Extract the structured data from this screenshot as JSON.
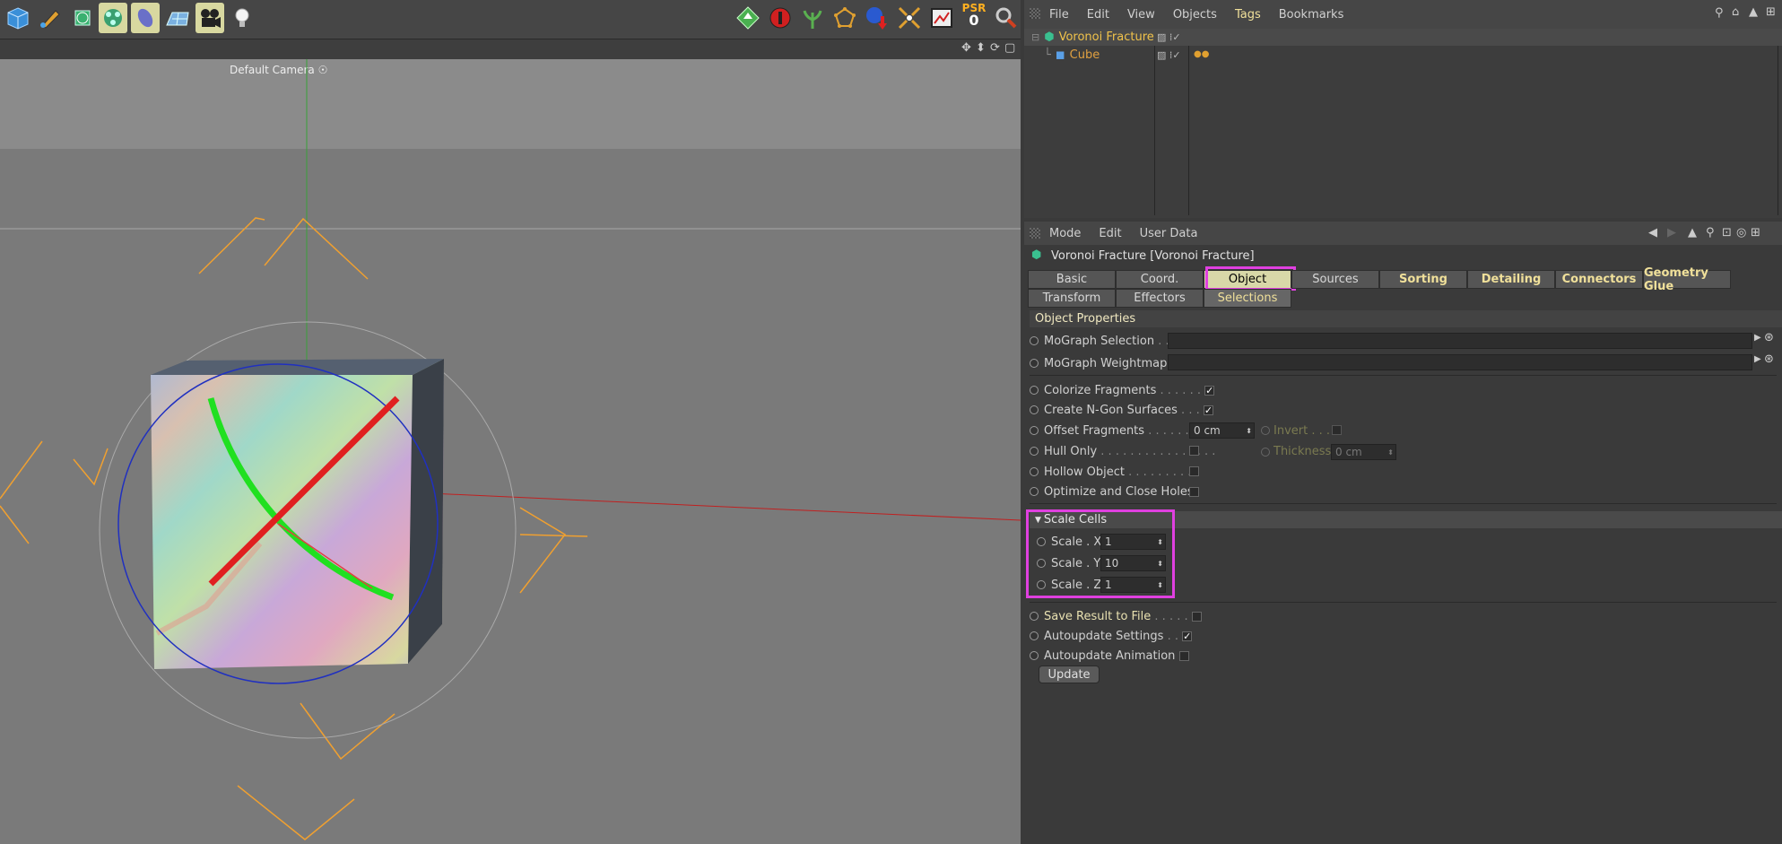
{
  "viewport": {
    "camera_label": "Default Camera"
  },
  "toolbar": {
    "psr_label": "PSR",
    "psr_value": "0"
  },
  "object_manager": {
    "menu": [
      "File",
      "Edit",
      "View",
      "Objects",
      "Tags",
      "Bookmarks"
    ],
    "objects": [
      {
        "name": "Voronoi Fracture"
      },
      {
        "name": "Cube"
      }
    ]
  },
  "attribute_manager": {
    "menu": [
      "Mode",
      "Edit",
      "User Data"
    ],
    "title": "Voronoi Fracture [Voronoi Fracture]",
    "tabs_row1": [
      "Basic",
      "Coord.",
      "Object",
      "Sources",
      "Sorting",
      "Detailing",
      "Connectors",
      "Geometry Glue"
    ],
    "tabs_row2": [
      "Transform",
      "Effectors",
      "Selections"
    ],
    "section_title": "Object Properties",
    "props": {
      "mograph_selection": "MoGraph Selection",
      "mograph_weightmap": "MoGraph Weightmap",
      "colorize": "Colorize Fragments",
      "ngon": "Create N-Gon Surfaces",
      "offset": "Offset Fragments",
      "offset_value": "0 cm",
      "invert": "Invert",
      "hull_only": "Hull Only",
      "thickness": "Thickness",
      "thickness_value": "0 cm",
      "hollow": "Hollow Object",
      "optimize": "Optimize and Close Holes",
      "scale_cells": "Scale Cells",
      "scale_x_label": "Scale . X",
      "scale_x": "1",
      "scale_y_label": "Scale . Y",
      "scale_y": "10",
      "scale_z_label": "Scale . Z",
      "scale_z": "1",
      "save_result": "Save Result to File",
      "autoupdate_settings": "Autoupdate Settings",
      "autoupdate_animation": "Autoupdate Animation",
      "update_button": "Update"
    }
  }
}
